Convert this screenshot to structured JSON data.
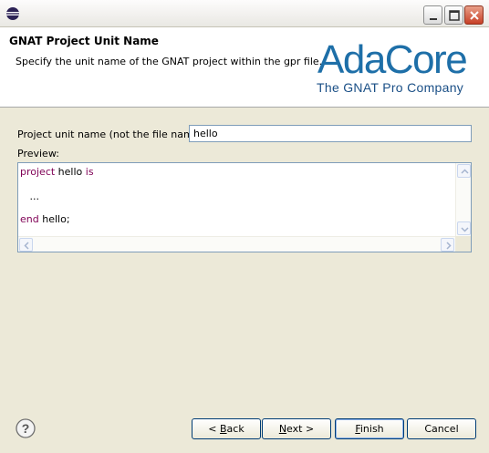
{
  "window": {
    "title": "",
    "controls": [
      "minimize",
      "maximize",
      "close"
    ]
  },
  "header": {
    "title": "GNAT Project Unit Name",
    "description": "Specify the unit name of the GNAT project within the gpr file.",
    "logo_name": "AdaCore",
    "logo_tagline": "The GNAT Pro Company"
  },
  "form": {
    "unit_name_label": "Project unit name (not the file name):",
    "unit_name_value": "hello",
    "preview_label": "Preview:"
  },
  "preview": {
    "line1_kw": "project",
    "line1_name": " hello ",
    "line1_kw2": "is",
    "line2": "   ...",
    "line3_kw": "end",
    "line3_rest": " hello;"
  },
  "buttons": {
    "back_mnemonic": "B",
    "back_rest": "ack",
    "back_prefix": "< ",
    "next_mnemonic": "N",
    "next_rest": "ext >",
    "finish_mnemonic": "F",
    "finish_rest": "inish",
    "cancel": "Cancel"
  },
  "icons": {
    "app": "eclipse-icon",
    "help": "help-icon"
  },
  "colors": {
    "keyword": "#7f0055",
    "logo": "#1e6fa8"
  }
}
